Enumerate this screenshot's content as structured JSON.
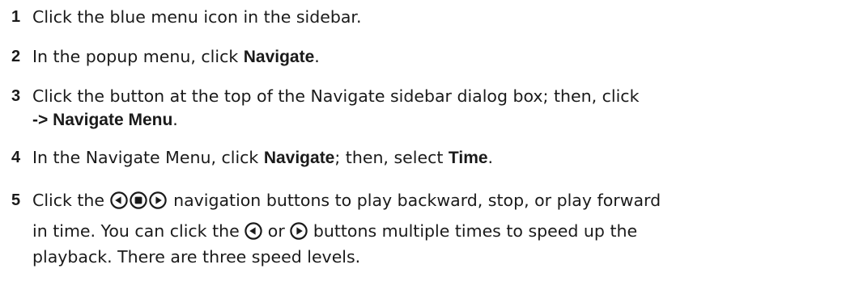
{
  "steps": [
    {
      "number": "1",
      "lines": [
        {
          "t1": "Click the blue menu icon in the sidebar."
        }
      ]
    },
    {
      "number": "2",
      "lines": [
        {
          "t1": "In the popup menu, click ",
          "b1": "Navigate",
          "t2": "."
        }
      ]
    },
    {
      "number": "3",
      "lines": [
        {
          "t1": "Click the button at the top of the Navigate sidebar dialog box; then, click"
        },
        {
          "b1": "-> Navigate Menu",
          "t2": "."
        }
      ]
    },
    {
      "number": "4",
      "lines": [
        {
          "t1": "In the Navigate Menu, click ",
          "b1": "Navigate",
          "t2": "; then, select ",
          "b2": "Time",
          "t3": "."
        }
      ]
    },
    {
      "number": "5",
      "lines": [
        {
          "t1": "Click the",
          "t2": "navigation buttons to play backward, stop, or play forward"
        },
        {
          "t1": "in time. You can click the",
          "t2": "or",
          "t3": "buttons multiple times to speed up the"
        },
        {
          "t1": "playback. There are three speed levels."
        }
      ]
    }
  ],
  "icons": {
    "backward": "play-backward-icon",
    "stop": "stop-icon",
    "forward": "play-forward-icon",
    "color": "#1a1a1a"
  }
}
